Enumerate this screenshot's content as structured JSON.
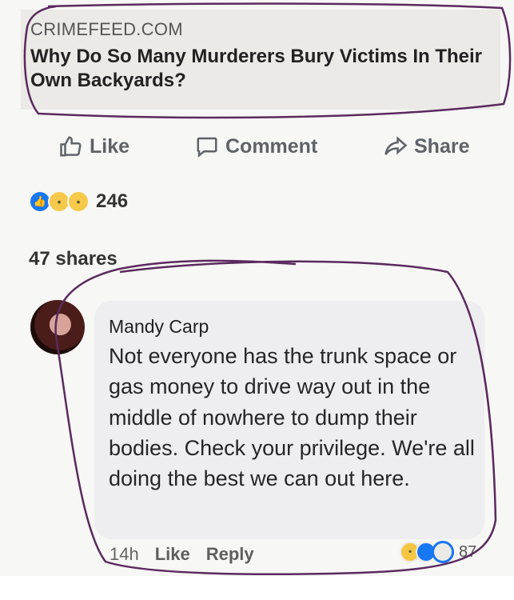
{
  "post": {
    "source": "CRIMEFEED.COM",
    "headline": "Why Do So Many Murderers Bury Victims In Their Own Backyards?"
  },
  "actions": {
    "like_label": "Like",
    "comment_label": "Comment",
    "share_label": "Share"
  },
  "stats": {
    "reaction_count": "246",
    "shares_text": "47 shares"
  },
  "comment": {
    "author": "Mandy Carp",
    "text": "Not everyone has the trunk space or gas money to drive way out in the middle of nowhere to dump their bodies. Check your privilege. We're all doing the best we can out here.",
    "time": "14h",
    "like_label": "Like",
    "reply_label": "Reply",
    "reaction_count": "87"
  },
  "icons": {
    "like": "thumbs-up-icon",
    "comment": "speech-bubble-icon",
    "share": "share-arrow-icon"
  },
  "colors": {
    "facebook_blue": "#1877f2",
    "annotation_ink": "#5a2a5e"
  }
}
